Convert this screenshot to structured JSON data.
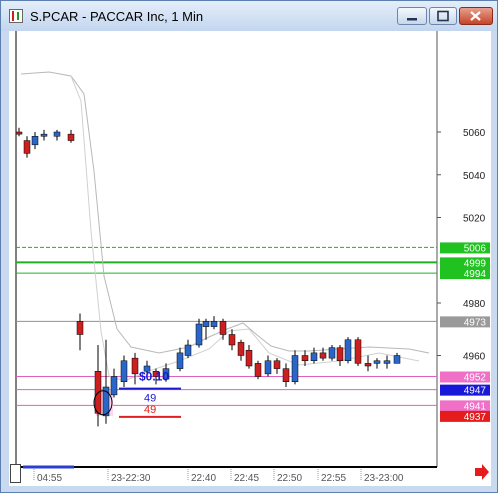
{
  "window": {
    "title": "S.PCAR - PACCAR Inc, 1 Min"
  },
  "colors": {
    "background": "#ffffff",
    "up_candle": "#2a66c8",
    "down_candle": "#cc1f1f",
    "green_level": "#22b022",
    "pink_level": "#e060c0",
    "blue_level": "#1a1ad0",
    "red_level": "#e02020",
    "gray_level": "#909090"
  },
  "chart_data": {
    "type": "candlestick",
    "title": "S.PCAR - PACCAR Inc, 1 Min",
    "y_ticks": [
      4960,
      4980,
      5020,
      5040,
      5060
    ],
    "x_ticks": [
      "04:55",
      "23-22:30",
      "22:40",
      "22:45",
      "22:50",
      "22:55",
      "23-23:00"
    ],
    "price_tags": [
      {
        "value": "5006",
        "color": "#1fc21f",
        "text_color": "#ffffff",
        "v": 5006
      },
      {
        "value": "4999",
        "color": "#1fc21f",
        "text_color": "#ffffff",
        "v": 4999
      },
      {
        "value": "4994",
        "color": "#1fc21f",
        "text_color": "#ffffff",
        "v": 4994
      },
      {
        "value": "4973",
        "color": "#9a9a9a",
        "text_color": "#ffffff",
        "v": 4973
      },
      {
        "value": "4952",
        "color": "#f070c8",
        "text_color": "#ffffff",
        "v": 4952
      },
      {
        "value": "4947",
        "color": "#1818d8",
        "text_color": "#ffffff",
        "v": 4947
      },
      {
        "value": "4941",
        "color": "#f070c8",
        "text_color": "#ffffff",
        "v": 4941
      },
      {
        "value": "4937",
        "color": "#e41c1c",
        "text_color": "#ffffff",
        "v": 4937
      }
    ],
    "annotations": [
      {
        "text": "$0.10",
        "color": "#1818d8"
      },
      {
        "text": "49",
        "color": "#1818d8"
      },
      {
        "text": "49",
        "color": "#e41c1c"
      }
    ],
    "candles": [
      {
        "o": 5060,
        "h": 5062,
        "l": 5058,
        "c": 5059
      },
      {
        "o": 5056,
        "h": 5058,
        "l": 5048,
        "c": 5050
      },
      {
        "o": 5054,
        "h": 5060,
        "l": 5052,
        "c": 5058
      },
      {
        "o": 5058,
        "h": 5061,
        "l": 5056,
        "c": 5059
      },
      {
        "o": 5058,
        "h": 5061,
        "l": 5056,
        "c": 5060
      },
      {
        "o": 5059,
        "h": 5061,
        "l": 5055,
        "c": 5056
      },
      {
        "o": 4973,
        "h": 4976,
        "l": 4962,
        "c": 4968
      },
      {
        "o": 4954,
        "h": 4964,
        "l": 4933,
        "c": 4938
      },
      {
        "o": 4937,
        "h": 4966,
        "l": 4934,
        "c": 4948
      },
      {
        "o": 4945,
        "h": 4955,
        "l": 4944,
        "c": 4952
      },
      {
        "o": 4950,
        "h": 4960,
        "l": 4948,
        "c": 4958
      },
      {
        "o": 4959,
        "h": 4961,
        "l": 4949,
        "c": 4953
      },
      {
        "o": 4954,
        "h": 4958,
        "l": 4951,
        "c": 4956
      },
      {
        "o": 4954,
        "h": 4955,
        "l": 4949,
        "c": 4952
      },
      {
        "o": 4951,
        "h": 4957,
        "l": 4950,
        "c": 4955
      },
      {
        "o": 4955,
        "h": 4963,
        "l": 4954,
        "c": 4961
      },
      {
        "o": 4960,
        "h": 4966,
        "l": 4959,
        "c": 4964
      },
      {
        "o": 4964,
        "h": 4974,
        "l": 4963,
        "c": 4972
      },
      {
        "o": 4971,
        "h": 4974,
        "l": 4966,
        "c": 4973
      },
      {
        "o": 4971,
        "h": 4975,
        "l": 4970,
        "c": 4973
      },
      {
        "o": 4973,
        "h": 4974,
        "l": 4966,
        "c": 4968
      },
      {
        "o": 4968,
        "h": 4970,
        "l": 4962,
        "c": 4964
      },
      {
        "o": 4965,
        "h": 4966,
        "l": 4958,
        "c": 4960
      },
      {
        "o": 4962,
        "h": 4964,
        "l": 4955,
        "c": 4956
      },
      {
        "o": 4957,
        "h": 4958,
        "l": 4951,
        "c": 4952
      },
      {
        "o": 4953,
        "h": 4960,
        "l": 4952,
        "c": 4958
      },
      {
        "o": 4958,
        "h": 4959,
        "l": 4953,
        "c": 4955
      },
      {
        "o": 4955,
        "h": 4957,
        "l": 4948,
        "c": 4950
      },
      {
        "o": 4950,
        "h": 4962,
        "l": 4949,
        "c": 4960
      },
      {
        "o": 4960,
        "h": 4962,
        "l": 4956,
        "c": 4958
      },
      {
        "o": 4958,
        "h": 4963,
        "l": 4957,
        "c": 4961
      },
      {
        "o": 4961,
        "h": 4963,
        "l": 4958,
        "c": 4959
      },
      {
        "o": 4959,
        "h": 4964,
        "l": 4958,
        "c": 4963
      },
      {
        "o": 4963,
        "h": 4964,
        "l": 4956,
        "c": 4958
      },
      {
        "o": 4958,
        "h": 4967,
        "l": 4957,
        "c": 4966
      },
      {
        "o": 4966,
        "h": 4967,
        "l": 4956,
        "c": 4957
      },
      {
        "o": 4957,
        "h": 4960,
        "l": 4954,
        "c": 4956
      },
      {
        "o": 4957,
        "h": 4959,
        "l": 4955,
        "c": 4958
      },
      {
        "o": 4957,
        "h": 4960,
        "l": 4955,
        "c": 4958
      },
      {
        "o": 4957,
        "h": 4961,
        "l": 4957,
        "c": 4960
      }
    ]
  }
}
